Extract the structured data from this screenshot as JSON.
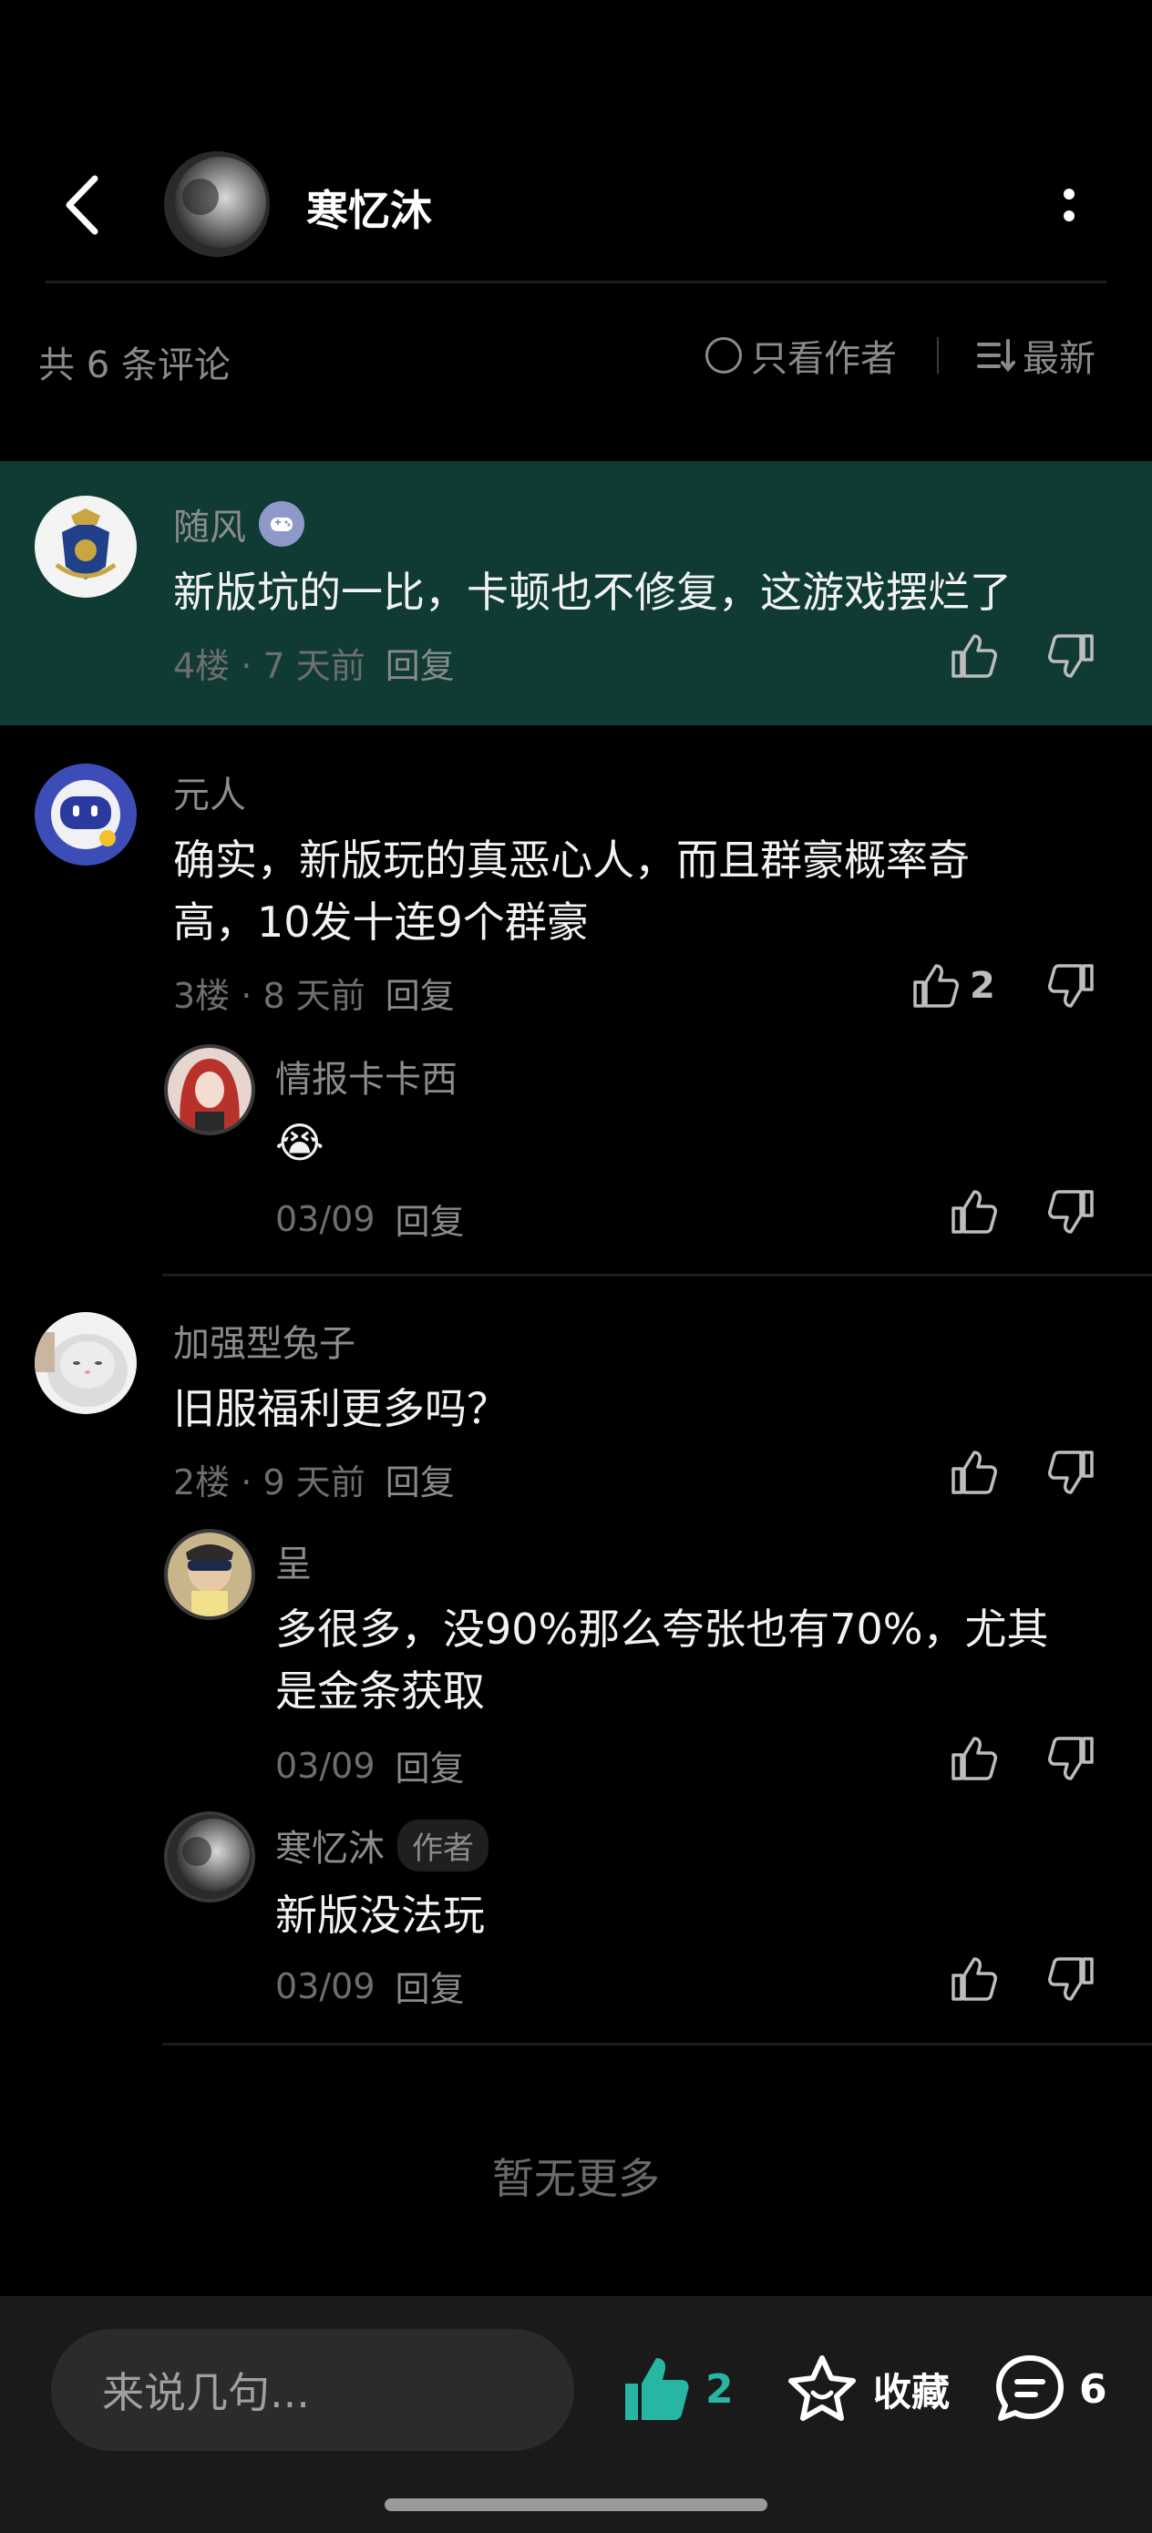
{
  "header": {
    "author_name": "寒忆沐",
    "back_icon": "chevron-left-icon",
    "more_icon": "more-vertical-icon"
  },
  "filter": {
    "count_label": "共 6 条评论",
    "author_only_label": "只看作者",
    "sort_label": "最新"
  },
  "comments": [
    {
      "user": "随风",
      "badge": "game-controller-icon",
      "text": "新版坑的一比，卡顿也不修复，这游戏摆烂了",
      "floor": "4楼",
      "time": "7 天前",
      "reply": "回复",
      "likes": "",
      "highlighted": true
    },
    {
      "user": "元人",
      "text_line1": "确实，新版玩的真恶心人，而且群豪概率奇",
      "text_line2": "高，10发十连9个群豪",
      "floor": "3楼",
      "time": "8 天前",
      "reply": "回复",
      "likes": "2",
      "replies": [
        {
          "user": "情报卡卡西",
          "text": "😭",
          "date": "03/09",
          "reply": "回复"
        }
      ]
    },
    {
      "user": "加强型兔子",
      "text": "旧服福利更多吗？",
      "floor": "2楼",
      "time": "9 天前",
      "reply": "回复",
      "likes": "",
      "replies": [
        {
          "user": "呈",
          "text_line1": "多很多，没90%那么夸张也有70%，尤其",
          "text_line2": "是金条获取",
          "date": "03/09",
          "reply": "回复"
        },
        {
          "user": "寒忆沐",
          "badge": "作者",
          "text": "新版没法玩",
          "date": "03/09",
          "reply": "回复"
        }
      ]
    }
  ],
  "footer_text": "暂无更多",
  "bottom_bar": {
    "input_placeholder": "来说几句...",
    "like_count": "2",
    "favorite_label": "收藏",
    "comment_count": "6"
  },
  "colors": {
    "highlight_bg": "#0f3b34",
    "accent": "#27b5a4"
  }
}
